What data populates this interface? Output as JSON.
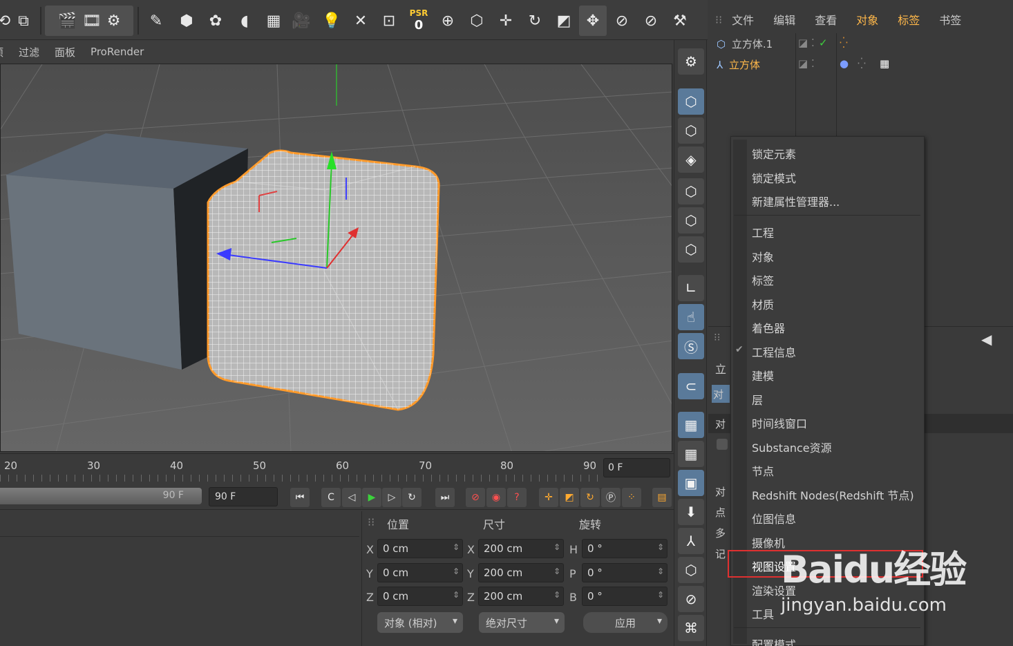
{
  "viewport_menu": [
    "项",
    "过滤",
    "面板",
    "ProRender"
  ],
  "psr": {
    "label": "PSR",
    "value": "0"
  },
  "object_manager": {
    "menu": [
      {
        "label": "文件",
        "highlight": false
      },
      {
        "label": "编辑",
        "highlight": false
      },
      {
        "label": "查看",
        "highlight": false
      },
      {
        "label": "对象",
        "highlight": true
      },
      {
        "label": "标签",
        "highlight": true
      },
      {
        "label": "书签",
        "highlight": false
      }
    ],
    "objects": [
      {
        "name": "立方体.1",
        "selected": false
      },
      {
        "name": "立方体",
        "selected": true
      }
    ]
  },
  "timeline": {
    "ticks": [
      "20",
      "30",
      "40",
      "50",
      "60",
      "70",
      "80",
      "90"
    ],
    "current_frame": "0 F",
    "scrub_end": "90 F",
    "end_frame": "90 F"
  },
  "coordinates": {
    "headers": {
      "position": "位置",
      "size": "尺寸",
      "rotation": "旋转"
    },
    "rows": [
      {
        "axis": "X",
        "pos": "0 cm",
        "size_axis": "X",
        "size": "200 cm",
        "rot_axis": "H",
        "rot": "0 °"
      },
      {
        "axis": "Y",
        "pos": "0 cm",
        "size_axis": "Y",
        "size": "200 cm",
        "rot_axis": "P",
        "rot": "0 °"
      },
      {
        "axis": "Z",
        "pos": "0 cm",
        "size_axis": "Z",
        "size": "200 cm",
        "rot_axis": "B",
        "rot": "0 °"
      }
    ],
    "mode_dropdown": "对象 (相对)",
    "size_dropdown": "绝对尺寸",
    "apply_button": "应用"
  },
  "attribute_manager": {
    "tab_partial": "立",
    "obj_tab_partial": "对象",
    "obj_label_partial": "对",
    "labels_partial": [
      "对",
      "点",
      "多",
      "记"
    ]
  },
  "context_menu": {
    "group1": [
      "锁定元素",
      "锁定模式",
      "新建属性管理器..."
    ],
    "group2": [
      {
        "label": "工程",
        "checked": false
      },
      {
        "label": "对象",
        "checked": false
      },
      {
        "label": "标签",
        "checked": false
      },
      {
        "label": "材质",
        "checked": false
      },
      {
        "label": "着色器",
        "checked": false
      },
      {
        "label": "工程信息",
        "checked": true
      },
      {
        "label": "建模",
        "checked": false
      },
      {
        "label": "层",
        "checked": false
      },
      {
        "label": "时间线窗口",
        "checked": false
      },
      {
        "label": "Substance资源",
        "checked": false
      },
      {
        "label": "节点",
        "checked": false
      },
      {
        "label": "Redshift Nodes(Redshift 节点)",
        "checked": false
      },
      {
        "label": "位图信息",
        "checked": false
      },
      {
        "label": "摄像机",
        "checked": false
      },
      {
        "label": "视图设置",
        "checked": false,
        "highlighted": true
      },
      {
        "label": "渲染设置",
        "checked": false
      },
      {
        "label": "工具",
        "checked": false
      }
    ],
    "group3": [
      "配置模式"
    ]
  },
  "watermark": {
    "logo": "Baidu经验",
    "url": "jingyan.baidu.com"
  },
  "colors": {
    "accent_orange": "#ffb84a",
    "highlight_box": "#e03030",
    "active_button": "#5a7a9a"
  }
}
